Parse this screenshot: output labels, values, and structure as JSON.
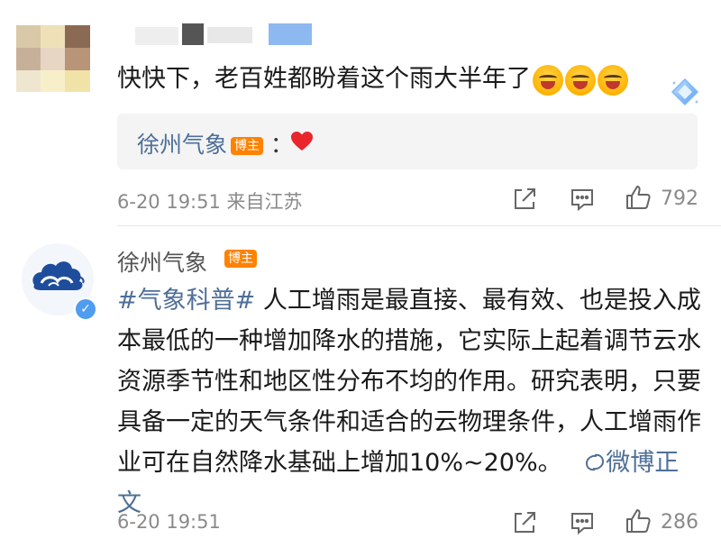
{
  "comment1": {
    "text": "快快下，老百姓都盼着这个雨大半年了",
    "emojis": [
      "crying-laugh-emoji",
      "crying-laugh-emoji",
      "crying-laugh-emoji"
    ],
    "reply": {
      "author": "徐州气象",
      "tag": "博主",
      "separator": "：",
      "content_icon": "heart-icon"
    },
    "meta": "6-20 19:51 来自江苏",
    "like_count": "792"
  },
  "comment2": {
    "author": "徐州气象",
    "tag": "博主",
    "hashtag": "#气象科普#",
    "text": " 人工增雨是最直接、最有效、也是投入成本最低的一种增加降水的措施，它实际上起着调节云水资源季节性和地区性分布不均的作用。研究表明，只要具备一定的天气条件和适合的云物理条件，人工增雨作业可在自然降水基础上增加10%~20%。",
    "fulltext_link": "微博正文",
    "meta": "6-20 19:51",
    "like_count": "286"
  },
  "colors": {
    "link": "#4e6f98",
    "tag_bg": "#ff8200",
    "meta": "#8a8a8a",
    "verify": "#4f9df0"
  }
}
